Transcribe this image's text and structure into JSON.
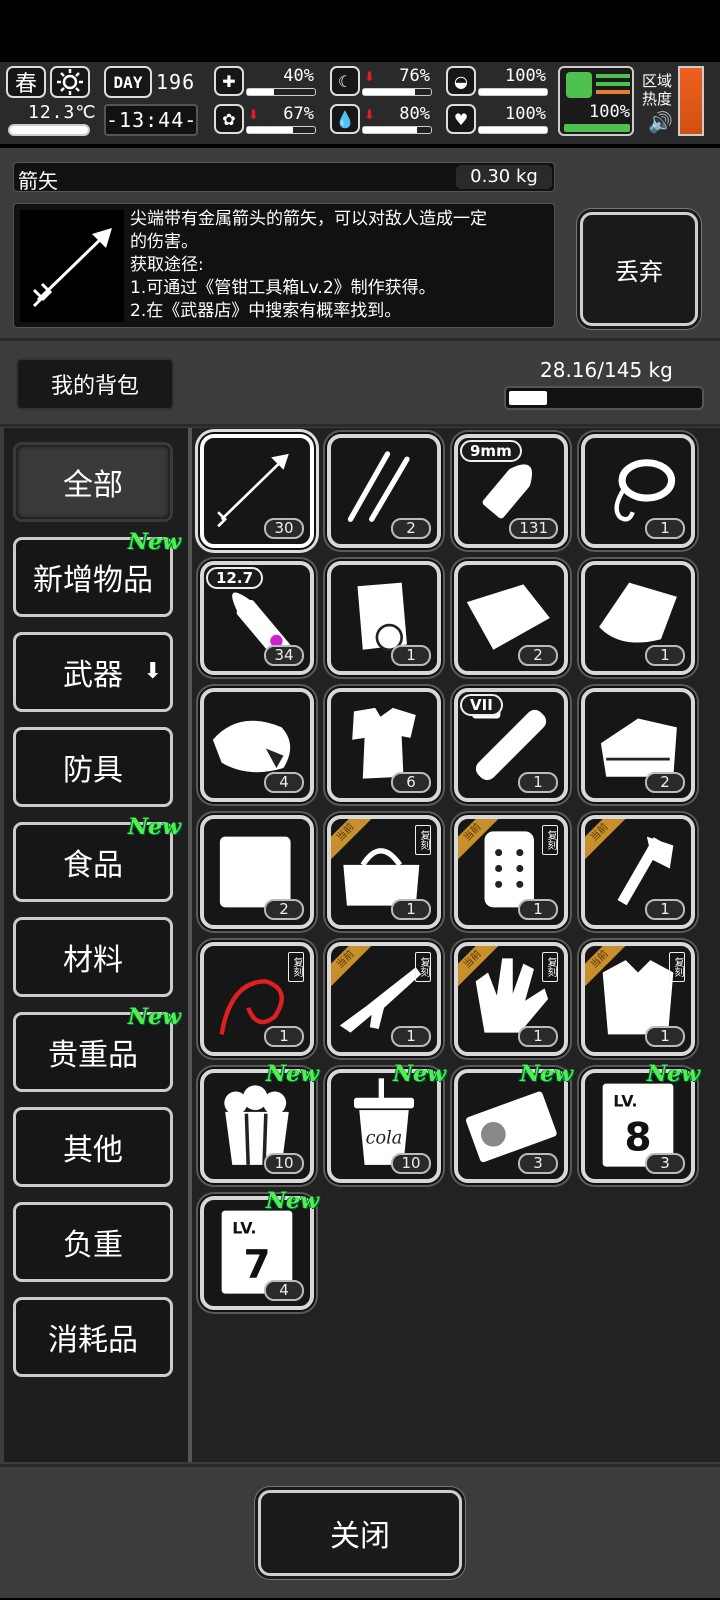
{
  "hud": {
    "season": "春",
    "weather_icon": "sun-icon",
    "temperature": "12.3℃",
    "day_label": "DAY",
    "day_number": "196",
    "clock": "-13:44-",
    "stats": [
      {
        "icon": "medkit-icon",
        "pct": "40%",
        "fill": 0.4,
        "down": false
      },
      {
        "icon": "stomach-icon",
        "pct": "76%",
        "fill": 0.76,
        "down": true
      },
      {
        "icon": "helmet-icon",
        "pct": "100%",
        "fill": 1.0,
        "down": false
      },
      {
        "icon": "brain-icon",
        "pct": "67%",
        "fill": 0.67,
        "down": true
      },
      {
        "icon": "water-drop-icon",
        "pct": "80%",
        "fill": 0.8,
        "down": true
      },
      {
        "icon": "heart-icon",
        "pct": "100%",
        "fill": 1.0,
        "down": false
      }
    ],
    "stamina_pct": "100%",
    "area_heat_label1": "区域",
    "area_heat_label2": "热度",
    "colors": {
      "stamina": "#4ec24e",
      "heat": "#e06820"
    }
  },
  "item": {
    "name": "箭矢",
    "weight": "0.30 kg",
    "desc_line1": "尖端带有金属箭头的箭矢，可以对敌人造成一定",
    "desc_line2": "的伤害。",
    "desc_line3": "获取途径:",
    "desc_line4": "1.可通过《管钳工具箱Lv.2》制作获得。",
    "desc_line5": "2.在《武器店》中搜索有概率找到。",
    "discard_label": "丢弃"
  },
  "bag": {
    "title": "我的背包",
    "weight": "28.16/145 kg",
    "fill": 0.194
  },
  "categories": [
    {
      "label": "全部",
      "new": false
    },
    {
      "label": "新增物品",
      "new": true
    },
    {
      "label": "武器",
      "new": false
    },
    {
      "label": "防具",
      "new": false
    },
    {
      "label": "食品",
      "new": true
    },
    {
      "label": "材料",
      "new": false
    },
    {
      "label": "贵重品",
      "new": true
    },
    {
      "label": "其他",
      "new": false
    },
    {
      "label": "负重",
      "new": false
    },
    {
      "label": "消耗品",
      "new": false
    }
  ],
  "new_label": "New",
  "ribbon_label": "当前",
  "copy_label": "复刻",
  "items": [
    {
      "icon": "arrow-icon",
      "count": "30"
    },
    {
      "icon": "lockpick-icon",
      "count": "2"
    },
    {
      "icon": "bullet-9mm-icon",
      "count": "131",
      "tag": "9mm"
    },
    {
      "icon": "rope-icon",
      "count": "1"
    },
    {
      "icon": "bullet-12-7-icon",
      "count": "34",
      "tag": "12.7"
    },
    {
      "icon": "cloth-roll-icon",
      "count": "1"
    },
    {
      "icon": "fabric-sheet-icon",
      "count": "2"
    },
    {
      "icon": "towel-icon",
      "count": "1"
    },
    {
      "icon": "meat-icon",
      "count": "4"
    },
    {
      "icon": "torn-shirt-icon",
      "count": "6"
    },
    {
      "icon": "test-tube-icon",
      "count": "1",
      "tag": "VII"
    },
    {
      "icon": "folded-cloth-icon",
      "count": "2"
    },
    {
      "icon": "white-cloth-icon",
      "count": "2"
    },
    {
      "icon": "duffel-bag-icon",
      "count": "1"
    },
    {
      "icon": "armor-plate-icon",
      "count": "1"
    },
    {
      "icon": "hatchet-icon",
      "count": "1"
    },
    {
      "icon": "whip-icon",
      "count": "1"
    },
    {
      "icon": "rifle-icon",
      "count": "1"
    },
    {
      "icon": "gloves-icon",
      "count": "1"
    },
    {
      "icon": "coat-icon",
      "count": "1"
    },
    {
      "icon": "popcorn-icon",
      "count": "10"
    },
    {
      "icon": "cola-cup-icon",
      "count": "10",
      "text": "cola"
    },
    {
      "icon": "id-card-icon",
      "count": "3"
    },
    {
      "icon": "level-card-8-icon",
      "count": "3",
      "text": "8"
    },
    {
      "icon": "level-card-7-icon",
      "count": "4",
      "text": "7"
    }
  ],
  "close_label": "关闭"
}
